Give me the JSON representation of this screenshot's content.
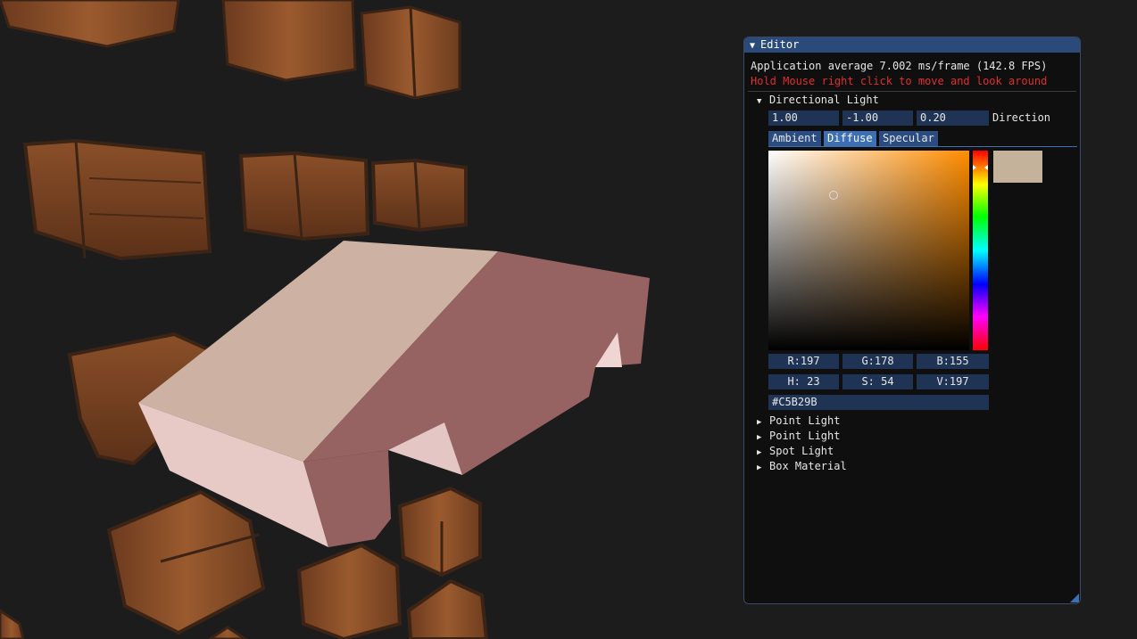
{
  "editor": {
    "title": "Editor",
    "fps_text": "Application average 7.002 ms/frame (142.8 FPS)",
    "hint_text": "Hold Mouse right click to move and look around",
    "directional_light": {
      "label": "Directional Light",
      "direction": [
        "1.00",
        "-1.00",
        "0.20"
      ],
      "direction_label": "Direction",
      "tabs": [
        "Ambient",
        "Diffuse",
        "Specular"
      ],
      "active_tab": "Diffuse",
      "color": {
        "hex": "#C5B29B",
        "rgb": [
          "R:197",
          "G:178",
          "B:155"
        ],
        "hsv": [
          "H: 23",
          "S: 54",
          "V:197"
        ],
        "swatch_color": "#c5b29b"
      }
    },
    "collapsed_sections": [
      "Point Light",
      "Point Light",
      "Spot Light",
      "Box Material"
    ]
  },
  "colors": {
    "panel_bg": "#0f0f0f",
    "title_bg": "#2a4a7a",
    "field_bg": "#1f3455",
    "tab_active": "#3c6fb3",
    "hint_red": "#e02f2f",
    "scene_bg": "#1c1c1c"
  },
  "icons": {
    "title_collapse": "triangle-down-icon",
    "tree_open": "triangle-down-icon",
    "tree_closed": "triangle-right-icon"
  }
}
